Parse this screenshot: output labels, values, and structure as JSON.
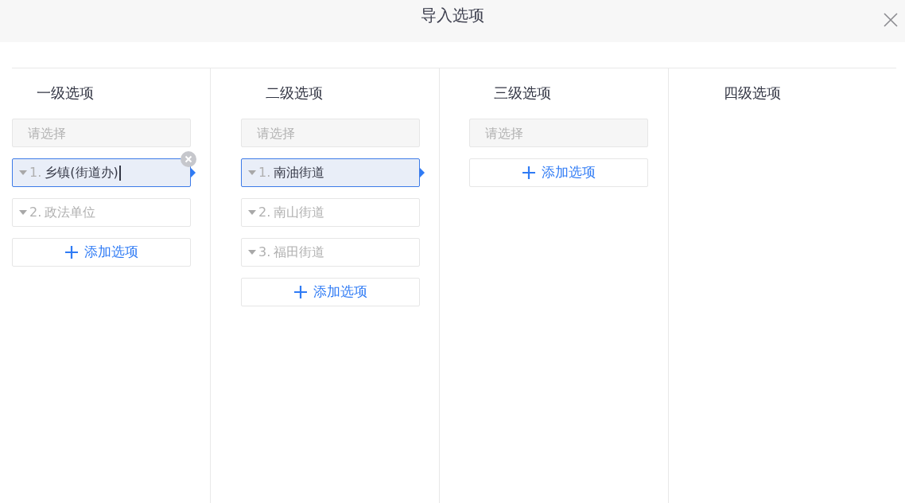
{
  "dialog": {
    "title": "导入选项"
  },
  "levels": [
    {
      "heading": "一级选项",
      "placeholder": "请选择",
      "options": [
        {
          "number": "1.",
          "label": "乡镇(街道办)",
          "selected": true,
          "editing": true
        },
        {
          "number": "2.",
          "label": "政法单位",
          "selected": false,
          "editing": false
        }
      ],
      "add_button": "添加选项"
    },
    {
      "heading": "二级选项",
      "placeholder": "请选择",
      "options": [
        {
          "number": "1.",
          "label": "南油街道",
          "selected": true,
          "editing": false
        },
        {
          "number": "2.",
          "label": "南山街道",
          "selected": false,
          "editing": false
        },
        {
          "number": "3.",
          "label": "福田街道",
          "selected": false,
          "editing": false
        }
      ],
      "add_button": "添加选项"
    },
    {
      "heading": "三级选项",
      "placeholder": "请选择",
      "add_button": "添加选项"
    },
    {
      "heading": "四级选项"
    }
  ]
}
